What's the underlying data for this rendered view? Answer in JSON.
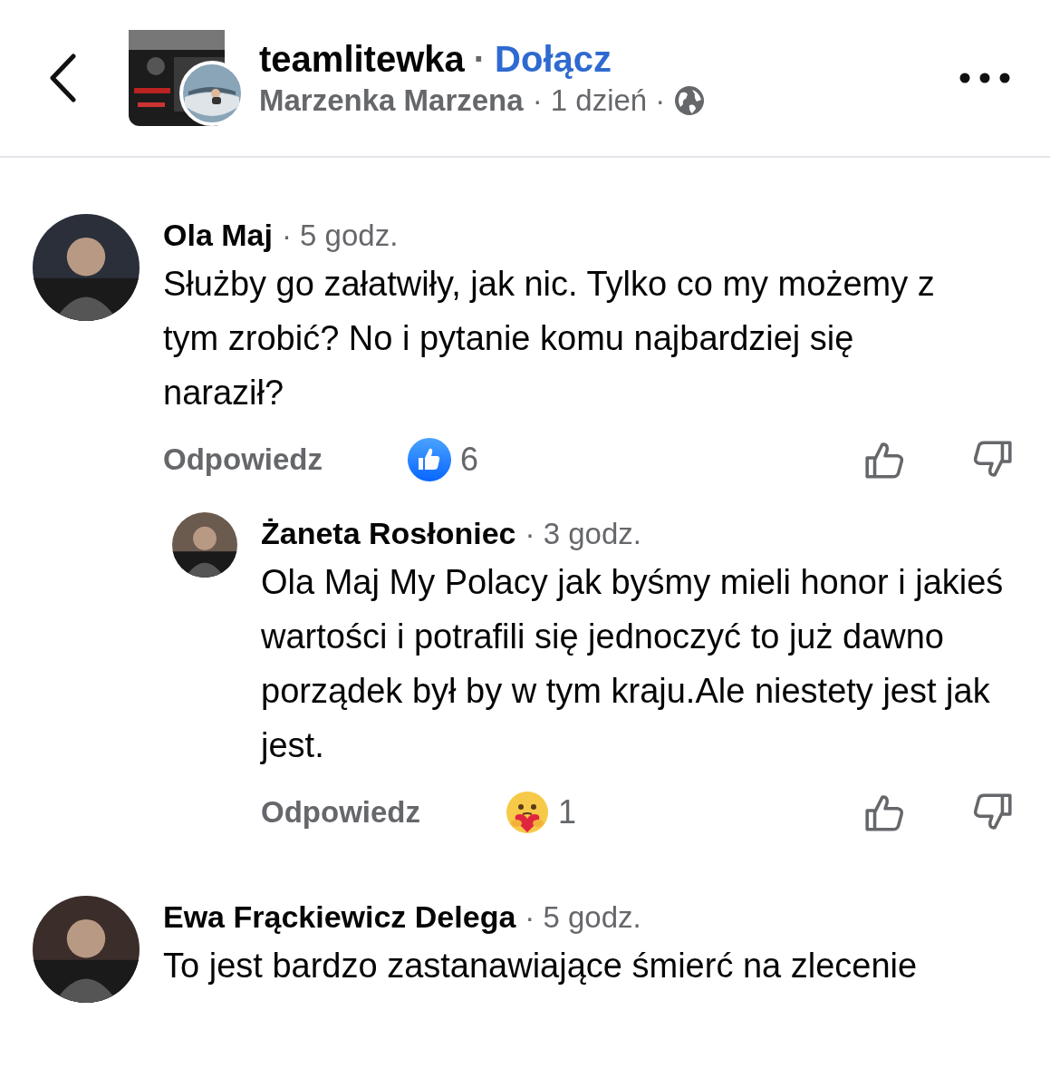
{
  "header": {
    "group": "teamlitewka",
    "separator": "·",
    "join": "Dołącz",
    "author": "Marzenka Marzena",
    "time": "· 1 dzień ·"
  },
  "comments": [
    {
      "name": "Ola Maj",
      "time": "· 5 godz.",
      "text": "Służby go załatwiły, jak nic. Tylko co my możemy z tym zrobić? No i pytanie komu najbardziej się naraził?",
      "reply": "Odpowiedz",
      "reaction": {
        "kind": "like",
        "count": "6"
      },
      "children": [
        {
          "name": "Żaneta Rosłoniec",
          "time": "· 3 godz.",
          "text": "Ola Maj My Polacy jak byśmy mieli honor i jakieś wartości i potrafili się jednoczyć to już dawno porządek był by w tym kraju.Ale niestety jest jak jest.",
          "reply": "Odpowiedz",
          "reaction": {
            "kind": "care",
            "count": "1"
          }
        }
      ]
    },
    {
      "name": "Ewa Frąckiewicz Delega",
      "time": "· 5 godz.",
      "text": "To jest bardzo zastanawiające śmierć na zlecenie"
    }
  ]
}
